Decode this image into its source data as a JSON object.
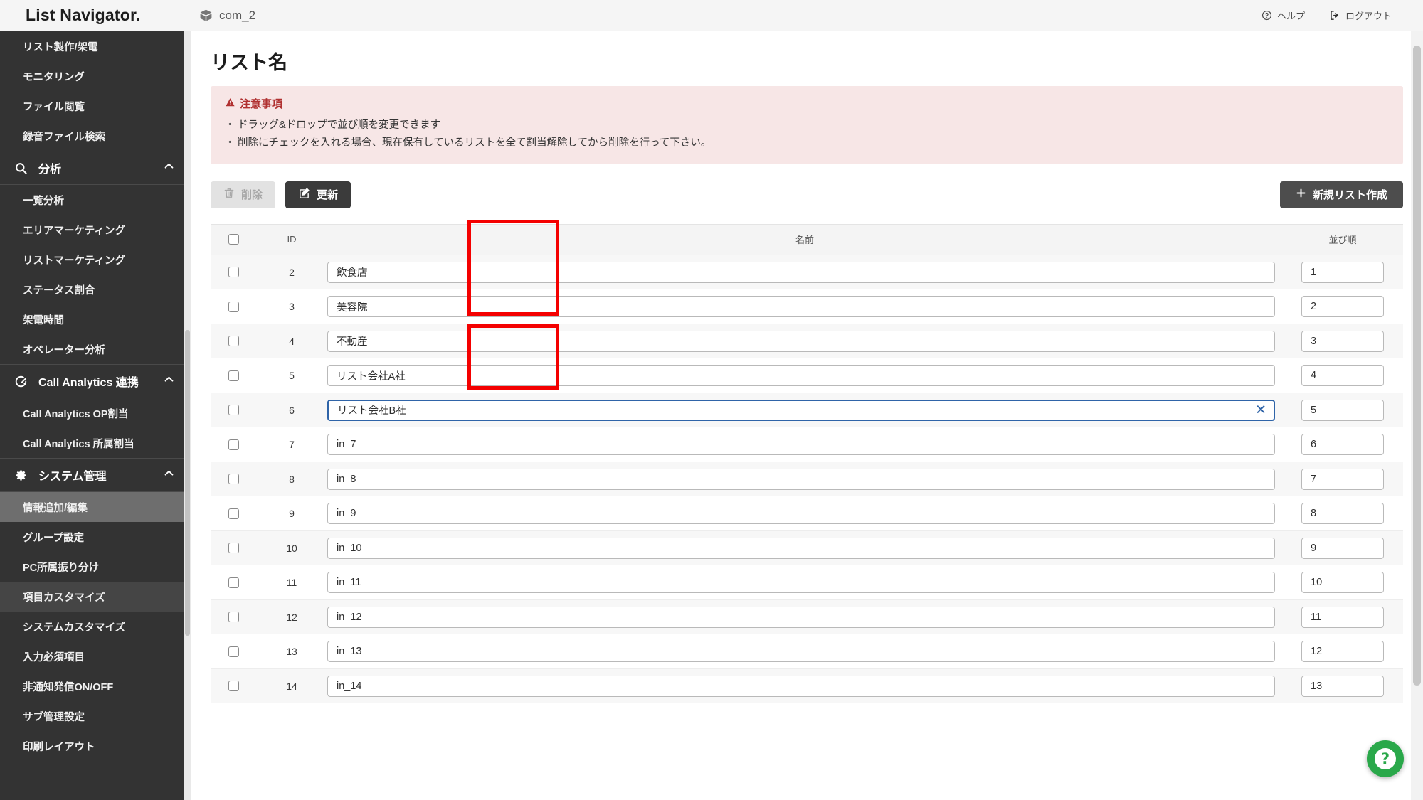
{
  "header": {
    "brand": "List Navigator.",
    "env_badge": "com_2",
    "env_icon": "cube-icon",
    "help_label": "ヘルプ",
    "help_icon": "question-circle-icon",
    "logout_label": "ログアウト",
    "logout_icon": "logout-icon"
  },
  "sidebar": {
    "items": [
      {
        "label": "リスト製作/架電",
        "type": "sub",
        "state": "normal"
      },
      {
        "label": "モニタリング",
        "type": "sub",
        "state": "normal"
      },
      {
        "label": "ファイル閲覧",
        "type": "sub",
        "state": "normal"
      },
      {
        "label": "録音ファイル検索",
        "type": "sub",
        "state": "normal"
      },
      {
        "label": "分析",
        "type": "group",
        "icon": "search-icon",
        "chevron": "chevron-up-icon"
      },
      {
        "label": "一覧分析",
        "type": "sub",
        "state": "normal"
      },
      {
        "label": "エリアマーケティング",
        "type": "sub",
        "state": "normal"
      },
      {
        "label": "リストマーケティング",
        "type": "sub",
        "state": "normal"
      },
      {
        "label": "ステータス割合",
        "type": "sub",
        "state": "normal"
      },
      {
        "label": "架電時間",
        "type": "sub",
        "state": "normal"
      },
      {
        "label": "オペレーター分析",
        "type": "sub",
        "state": "normal"
      },
      {
        "label": "Call Analytics 連携",
        "type": "group",
        "icon": "analytics-icon",
        "chevron": "chevron-up-icon"
      },
      {
        "label": "Call Analytics OP割当",
        "type": "sub",
        "state": "normal"
      },
      {
        "label": "Call Analytics 所属割当",
        "type": "sub",
        "state": "normal"
      },
      {
        "label": "システム管理",
        "type": "group",
        "icon": "gear-icon",
        "chevron": "chevron-up-icon"
      },
      {
        "label": "情報追加/編集",
        "type": "sub",
        "state": "active"
      },
      {
        "label": "グループ設定",
        "type": "sub",
        "state": "normal"
      },
      {
        "label": "PC所属振り分け",
        "type": "sub",
        "state": "normal"
      },
      {
        "label": "項目カスタマイズ",
        "type": "sub",
        "state": "hover"
      },
      {
        "label": "システムカスタマイズ",
        "type": "sub",
        "state": "normal"
      },
      {
        "label": "入力必須項目",
        "type": "sub",
        "state": "normal"
      },
      {
        "label": "非通知発信ON/OFF",
        "type": "sub",
        "state": "normal"
      },
      {
        "label": "サブ管理設定",
        "type": "sub",
        "state": "normal"
      },
      {
        "label": "印刷レイアウト",
        "type": "sub",
        "state": "normal"
      }
    ]
  },
  "main": {
    "page_title": "リスト名",
    "notice": {
      "heading": "注意事項",
      "icon": "warning-triangle-icon",
      "lines": [
        "ドラッグ&ドロップで並び順を変更できます",
        "削除にチェックを入れる場合、現在保有しているリストを全て割当解除してから削除を行って下さい。"
      ]
    },
    "toolbar": {
      "delete_label": "削除",
      "delete_icon": "trash-icon",
      "delete_disabled": true,
      "update_label": "更新",
      "update_icon": "edit-pencil-icon",
      "new_list_label": "新規リスト作成",
      "new_list_icon": "plus-icon"
    },
    "table": {
      "columns": {
        "check": "",
        "id": "ID",
        "name": "名前",
        "order": "並び順"
      },
      "rows": [
        {
          "id": "2",
          "name": "飲食店",
          "order": "1",
          "checked": false,
          "focused": false
        },
        {
          "id": "3",
          "name": "美容院",
          "order": "2",
          "checked": false,
          "focused": false
        },
        {
          "id": "4",
          "name": "不動産",
          "order": "3",
          "checked": false,
          "focused": false
        },
        {
          "id": "5",
          "name": "リスト会社A社",
          "order": "4",
          "checked": false,
          "focused": false
        },
        {
          "id": "6",
          "name": "リスト会社B社",
          "order": "5",
          "checked": false,
          "focused": true,
          "clear_icon": "close-x-icon"
        },
        {
          "id": "7",
          "name": "in_7",
          "order": "6",
          "checked": false,
          "focused": false
        },
        {
          "id": "8",
          "name": "in_8",
          "order": "7",
          "checked": false,
          "focused": false
        },
        {
          "id": "9",
          "name": "in_9",
          "order": "8",
          "checked": false,
          "focused": false
        },
        {
          "id": "10",
          "name": "in_10",
          "order": "9",
          "checked": false,
          "focused": false
        },
        {
          "id": "11",
          "name": "in_11",
          "order": "10",
          "checked": false,
          "focused": false
        },
        {
          "id": "12",
          "name": "in_12",
          "order": "11",
          "checked": false,
          "focused": false
        },
        {
          "id": "13",
          "name": "in_13",
          "order": "12",
          "checked": false,
          "focused": false
        },
        {
          "id": "14",
          "name": "in_14",
          "order": "13",
          "checked": false,
          "focused": false
        }
      ]
    },
    "fab": {
      "icon": "question-mark-icon",
      "label": "?"
    }
  },
  "colors": {
    "sidebar_bg": "#333333",
    "sidebar_active": "#6e6e6e",
    "accent_dark": "#3b3b3b",
    "notice_bg": "#f7e6e6",
    "notice_text": "#b03030",
    "focus_blue": "#2f64a8",
    "annotation_red": "#f40000",
    "fab_green": "#2aa84a"
  }
}
